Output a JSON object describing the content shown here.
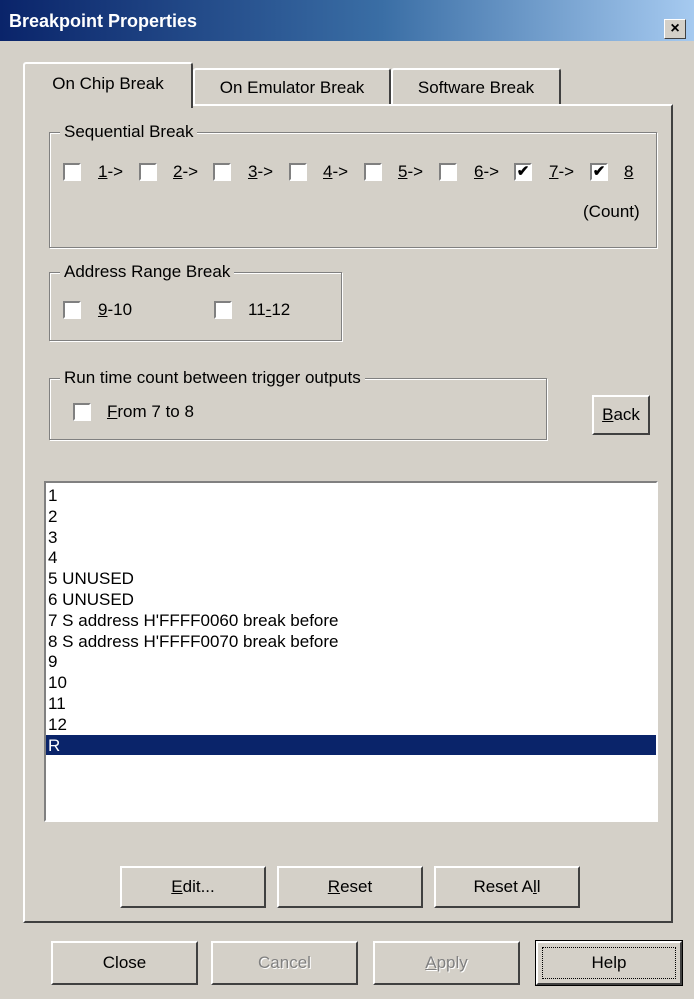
{
  "window": {
    "title": "Breakpoint Properties",
    "close_glyph": "×"
  },
  "tabs": [
    {
      "label": "On Chip Break",
      "active": true
    },
    {
      "label": "On Emulator Break",
      "active": false
    },
    {
      "label": "Software Break",
      "active": false
    }
  ],
  "sequential": {
    "title": "Sequential Break",
    "items": [
      {
        "label": "1->",
        "checked": false
      },
      {
        "label": "2->",
        "checked": false
      },
      {
        "label": "3->",
        "checked": false
      },
      {
        "label": "4->",
        "checked": false
      },
      {
        "label": "5->",
        "checked": false
      },
      {
        "label": "6->",
        "checked": false
      },
      {
        "label": "7->",
        "checked": true
      },
      {
        "label": "8",
        "checked": true
      }
    ],
    "count_label": "(Count)"
  },
  "address_range": {
    "title": "Address Range Break",
    "items": [
      {
        "label": "9-10",
        "checked": false
      },
      {
        "label": "11-12",
        "checked": false
      }
    ]
  },
  "runtime": {
    "title": "Run time count between trigger outputs",
    "item": {
      "label": "From 7 to 8",
      "checked": false
    }
  },
  "back_button": "Back",
  "breakpoint_list": [
    "1",
    "2",
    "3",
    "4",
    "5 UNUSED",
    "6 UNUSED",
    "7 S address H'FFFF0060 break before",
    "8 S address H'FFFF0070 break before",
    "9",
    "10",
    "11",
    "12",
    "R"
  ],
  "selected_list_item": "R",
  "actions": {
    "edit": "Edit...",
    "reset": "Reset",
    "reset_all": "Reset All"
  },
  "footer": {
    "close": "Close",
    "cancel": "Cancel",
    "apply": "Apply",
    "help": "Help"
  },
  "colors": {
    "selection": "#0a246a",
    "face": "#d4d0c8",
    "title_start": "#0a246a",
    "title_end": "#a6caf0"
  }
}
